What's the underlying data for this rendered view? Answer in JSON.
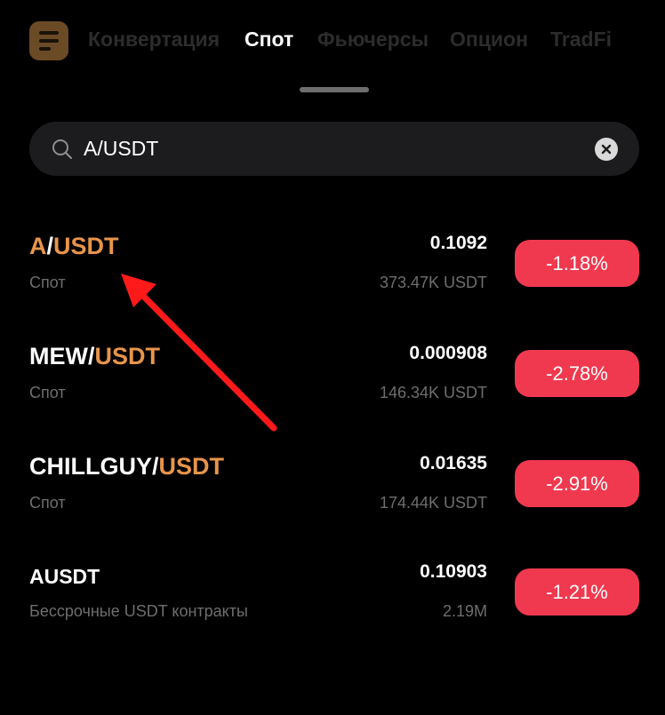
{
  "tabs": [
    {
      "label": "Конвертация",
      "active": false
    },
    {
      "label": "Спот",
      "active": true
    },
    {
      "label": "Фьючерсы",
      "active": false
    },
    {
      "label": "Опцион",
      "active": false
    },
    {
      "label": "TradFi",
      "active": false
    }
  ],
  "search": {
    "value": "A/USDT"
  },
  "results": [
    {
      "base": "A",
      "sep": "/",
      "quote": "USDT",
      "market": "Спот",
      "price": "0.1092",
      "volume": "373.47K USDT",
      "change": "-1.18%"
    },
    {
      "base": "MEW",
      "sep": "/",
      "quote": "USDT",
      "market": "Спот",
      "price": "0.000908",
      "volume": "146.34K USDT",
      "change": "-2.78%"
    },
    {
      "base": "CHILLGUY",
      "sep": "/",
      "quote": "USDT",
      "market": "Спот",
      "price": "0.01635",
      "volume": "174.44K USDT",
      "change": "-2.91%"
    },
    {
      "symbol": "AUSDT",
      "market": "Бессрочные USDT контракты",
      "price": "0.10903",
      "volume": "2.19M",
      "change": "-1.21%"
    }
  ],
  "colors": {
    "accent": "#e8954a",
    "negative": "#f0394f",
    "annotation_arrow": "#ff1a1a",
    "background": "#000000",
    "search_bg": "#1c1c1e"
  },
  "icons": [
    "menu-icon",
    "search-icon",
    "clear-icon"
  ]
}
